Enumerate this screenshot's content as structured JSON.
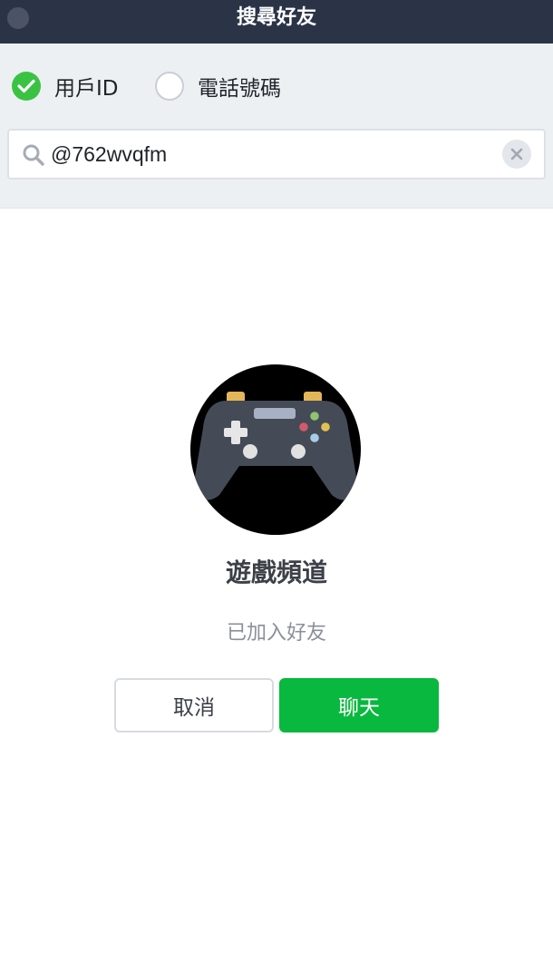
{
  "window": {
    "title": "搜尋好友"
  },
  "search_type": {
    "options": [
      {
        "label": "用戶ID",
        "selected": true
      },
      {
        "label": "電話號碼",
        "selected": false
      }
    ]
  },
  "search": {
    "value": "@762wvqfm",
    "search_icon": "search-icon",
    "clear_icon": "close-icon"
  },
  "result": {
    "avatar_icon": "gamepad-icon",
    "name": "遊戲頻道",
    "status": "已加入好友"
  },
  "actions": {
    "cancel_label": "取消",
    "chat_label": "聊天"
  },
  "colors": {
    "titlebar": "#2b3447",
    "panel": "#edf0f3",
    "check_green": "#3ac343",
    "chat_green": "#09b83e"
  }
}
